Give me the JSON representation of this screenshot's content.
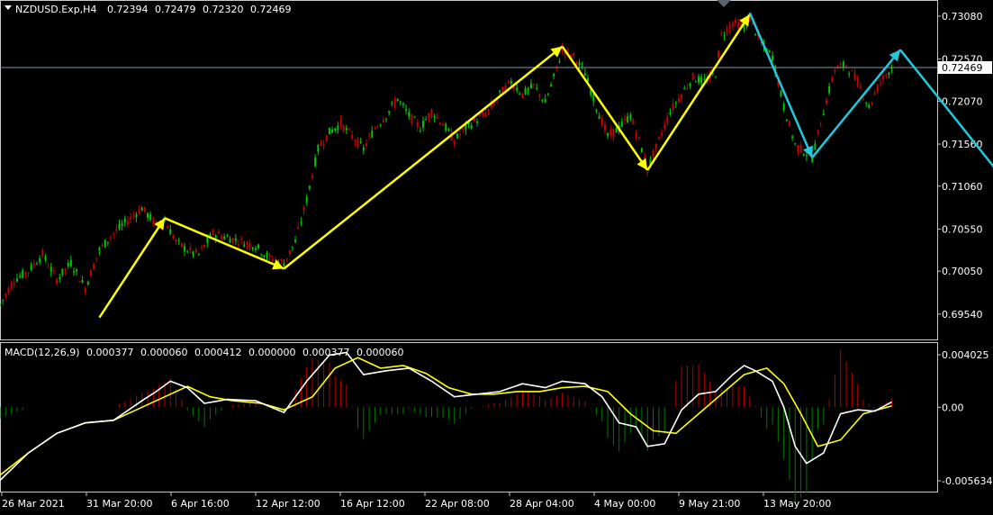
{
  "header": {
    "symbol": "NZDUSD.Exp,H4",
    "open": "0.72394",
    "high": "0.72479",
    "low": "0.72320",
    "close": "0.72469"
  },
  "macd_header": {
    "label": "MACD(12,26,9)",
    "v1": "0.000377",
    "v2": "0.000060",
    "v3": "0.000412",
    "v4": "0.000000",
    "v5": "0.000377",
    "v6": "0.000060"
  },
  "current_price": "0.72469",
  "colors": {
    "background": "#000000",
    "bull": "#00c800",
    "bear": "#c80000",
    "yellow_arrow": "#ffff00",
    "cyan_arrow": "#22c8dc",
    "macd_main": "#ffffff",
    "macd_signal": "#ffff00",
    "hist_pos": "#b40000",
    "hist_neg": "#007800"
  },
  "chart_data": [
    {
      "type": "candlestick",
      "title": "NZDUSD.Exp,H4",
      "yticks": [
        "0.73080",
        "0.72570",
        "0.72070",
        "0.71560",
        "0.71060",
        "0.70550",
        "0.70050",
        "0.69540"
      ],
      "ytick_values": [
        0.7308,
        0.7257,
        0.7207,
        0.7156,
        0.7106,
        0.7055,
        0.7005,
        0.6954
      ],
      "ylim": [
        0.6925,
        0.7325
      ],
      "xticks": [
        "26 Mar 2021",
        "31 Mar 20:00",
        "6 Apr 16:00",
        "12 Apr 12:00",
        "16 Apr 12:00",
        "22 Apr 08:00",
        "28 Apr 04:00",
        "4 May 00:00",
        "9 May 21:00",
        "13 May 20:00"
      ],
      "price_path": [
        [
          0,
          0.6965
        ],
        [
          5,
          0.6995
        ],
        [
          10,
          0.7005
        ],
        [
          15,
          0.7025
        ],
        [
          20,
          0.6995
        ],
        [
          25,
          0.7015
        ],
        [
          30,
          0.6985
        ],
        [
          35,
          0.703
        ],
        [
          40,
          0.705
        ],
        [
          45,
          0.7065
        ],
        [
          50,
          0.708
        ],
        [
          55,
          0.706
        ],
        [
          58,
          0.7065
        ],
        [
          62,
          0.704
        ],
        [
          66,
          0.703
        ],
        [
          70,
          0.7025
        ],
        [
          75,
          0.705
        ],
        [
          80,
          0.7045
        ],
        [
          85,
          0.704
        ],
        [
          90,
          0.7035
        ],
        [
          95,
          0.702
        ],
        [
          100,
          0.7015
        ],
        [
          104,
          0.704
        ],
        [
          108,
          0.709
        ],
        [
          112,
          0.715
        ],
        [
          116,
          0.717
        ],
        [
          120,
          0.718
        ],
        [
          124,
          0.7165
        ],
        [
          128,
          0.715
        ],
        [
          132,
          0.7175
        ],
        [
          136,
          0.719
        ],
        [
          140,
          0.721
        ],
        [
          144,
          0.719
        ],
        [
          148,
          0.7175
        ],
        [
          152,
          0.7195
        ],
        [
          156,
          0.718
        ],
        [
          160,
          0.716
        ],
        [
          164,
          0.7175
        ],
        [
          168,
          0.7185
        ],
        [
          172,
          0.7195
        ],
        [
          176,
          0.7215
        ],
        [
          180,
          0.723
        ],
        [
          184,
          0.7215
        ],
        [
          188,
          0.7225
        ],
        [
          192,
          0.7205
        ],
        [
          196,
          0.7245
        ],
        [
          198,
          0.7268
        ],
        [
          202,
          0.726
        ],
        [
          206,
          0.724
        ],
        [
          210,
          0.72
        ],
        [
          214,
          0.7165
        ],
        [
          218,
          0.7175
        ],
        [
          222,
          0.719
        ],
        [
          226,
          0.715
        ],
        [
          228,
          0.7125
        ],
        [
          232,
          0.716
        ],
        [
          236,
          0.7195
        ],
        [
          240,
          0.7215
        ],
        [
          244,
          0.7235
        ],
        [
          248,
          0.723
        ],
        [
          252,
          0.724
        ],
        [
          254,
          0.7285
        ],
        [
          258,
          0.73
        ],
        [
          262,
          0.7295
        ],
        [
          264,
          0.7305
        ],
        [
          268,
          0.7275
        ],
        [
          272,
          0.726
        ],
        [
          276,
          0.72
        ],
        [
          280,
          0.7155
        ],
        [
          284,
          0.7145
        ],
        [
          286,
          0.714
        ],
        [
          290,
          0.7195
        ],
        [
          294,
          0.7245
        ],
        [
          298,
          0.725
        ],
        [
          302,
          0.723
        ],
        [
          306,
          0.72
        ],
        [
          310,
          0.723
        ],
        [
          314,
          0.7247
        ]
      ],
      "yellow_zigzag": [
        [
          35,
          0.695
        ],
        [
          58,
          0.7068
        ],
        [
          100,
          0.7008
        ],
        [
          198,
          0.7272
        ],
        [
          228,
          0.7125
        ],
        [
          264,
          0.731
        ]
      ],
      "cyan_projection": [
        [
          264,
          0.7312
        ],
        [
          286,
          0.714
        ],
        [
          317,
          0.7268
        ],
        [
          362,
          0.7078
        ]
      ]
    },
    {
      "type": "macd",
      "title": "MACD(12,26,9)",
      "yticks": [
        "0.004025",
        "0.00",
        "-0.005634"
      ],
      "ytick_values": [
        0.004025,
        0.0,
        -0.005634
      ],
      "ylim": [
        -0.005634,
        0.004025
      ],
      "macd_line": [
        [
          0,
          -0.0056
        ],
        [
          10,
          -0.0035
        ],
        [
          20,
          -0.002
        ],
        [
          30,
          -0.0012
        ],
        [
          40,
          -0.001
        ],
        [
          50,
          0.0005
        ],
        [
          55,
          0.0012
        ],
        [
          60,
          0.002
        ],
        [
          66,
          0.0015
        ],
        [
          72,
          0.0003
        ],
        [
          80,
          0.0006
        ],
        [
          90,
          0.0005
        ],
        [
          100,
          -0.0004
        ],
        [
          108,
          0.002
        ],
        [
          116,
          0.004
        ],
        [
          122,
          0.0042
        ],
        [
          128,
          0.0025
        ],
        [
          136,
          0.0028
        ],
        [
          144,
          0.003
        ],
        [
          152,
          0.002
        ],
        [
          160,
          0.0008
        ],
        [
          168,
          0.001
        ],
        [
          176,
          0.0012
        ],
        [
          184,
          0.0018
        ],
        [
          192,
          0.0015
        ],
        [
          198,
          0.002
        ],
        [
          206,
          0.0018
        ],
        [
          212,
          0.0008
        ],
        [
          218,
          -0.0012
        ],
        [
          224,
          -0.0015
        ],
        [
          228,
          -0.003
        ],
        [
          234,
          -0.0028
        ],
        [
          240,
          -0.0002
        ],
        [
          246,
          0.001
        ],
        [
          252,
          0.0012
        ],
        [
          258,
          0.0025
        ],
        [
          262,
          0.0032
        ],
        [
          266,
          0.0028
        ],
        [
          272,
          0.002
        ],
        [
          276,
          0.0
        ],
        [
          280,
          -0.003
        ],
        [
          284,
          -0.0043
        ],
        [
          290,
          -0.0035
        ],
        [
          296,
          -0.0005
        ],
        [
          302,
          -0.0002
        ],
        [
          308,
          -0.0003
        ],
        [
          314,
          0.0004
        ]
      ],
      "signal_line": [
        [
          0,
          -0.0052
        ],
        [
          10,
          -0.0035
        ],
        [
          20,
          -0.002
        ],
        [
          30,
          -0.0012
        ],
        [
          40,
          -0.001
        ],
        [
          50,
          0.0
        ],
        [
          58,
          0.0008
        ],
        [
          66,
          0.0016
        ],
        [
          74,
          0.0008
        ],
        [
          82,
          0.0005
        ],
        [
          92,
          0.0003
        ],
        [
          100,
          -0.0002
        ],
        [
          110,
          0.0008
        ],
        [
          118,
          0.003
        ],
        [
          126,
          0.0038
        ],
        [
          134,
          0.003
        ],
        [
          142,
          0.0032
        ],
        [
          150,
          0.0026
        ],
        [
          158,
          0.0015
        ],
        [
          166,
          0.001
        ],
        [
          174,
          0.001
        ],
        [
          182,
          0.0012
        ],
        [
          190,
          0.0012
        ],
        [
          198,
          0.0015
        ],
        [
          206,
          0.0016
        ],
        [
          214,
          0.0012
        ],
        [
          222,
          -0.0005
        ],
        [
          230,
          -0.0018
        ],
        [
          238,
          -0.002
        ],
        [
          246,
          -0.0005
        ],
        [
          254,
          0.001
        ],
        [
          262,
          0.0025
        ],
        [
          270,
          0.003
        ],
        [
          276,
          0.0018
        ],
        [
          282,
          -0.0005
        ],
        [
          288,
          -0.003
        ],
        [
          296,
          -0.0025
        ],
        [
          304,
          -0.0005
        ],
        [
          314,
          0.0001
        ]
      ]
    }
  ]
}
